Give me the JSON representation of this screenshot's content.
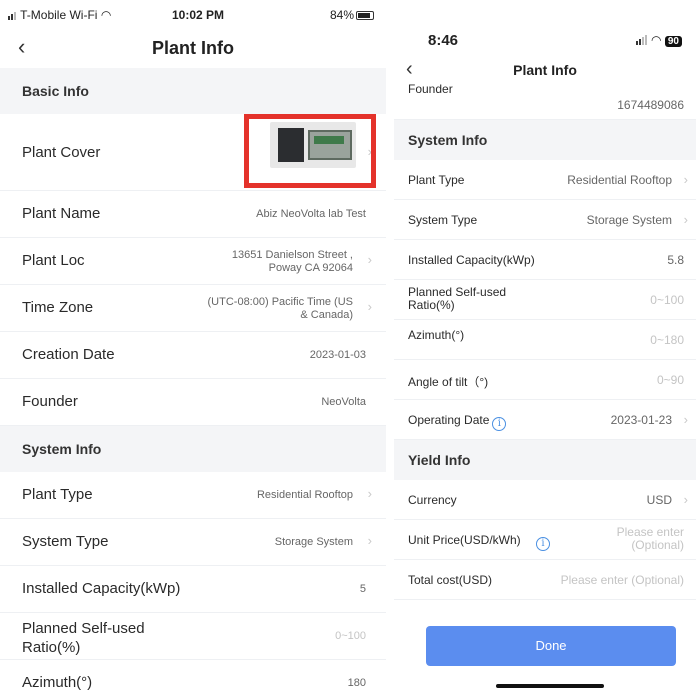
{
  "left": {
    "status": {
      "carrier": "T-Mobile Wi-Fi",
      "wifi_icon": "wifi-icon",
      "time": "10:02 PM",
      "battery": "84%"
    },
    "title": "Plant Info",
    "sections": {
      "basic": "Basic Info",
      "system": "System Info"
    },
    "rows": {
      "plant_cover": "Plant Cover",
      "plant_name": {
        "label": "Plant Name",
        "value": "Abiz NeoVolta lab Test"
      },
      "plant_loc": {
        "label": "Plant Loc",
        "line1": "13651 Danielson Street ,",
        "line2": "Poway CA 92064"
      },
      "time_zone": {
        "label": "Time Zone",
        "line1": "(UTC-08:00) Pacific Time (US",
        "line2": "& Canada)"
      },
      "creation_date": {
        "label": "Creation Date",
        "value": "2023-01-03"
      },
      "founder": {
        "label": "Founder",
        "value": "NeoVolta"
      },
      "plant_type": {
        "label": "Plant Type",
        "value": "Residential Rooftop"
      },
      "system_type": {
        "label": "System Type",
        "value": "Storage System"
      },
      "installed_capacity": {
        "label": "Installed Capacity(kWp)",
        "value": "5"
      },
      "self_used": {
        "label_line1": "Planned Self-used",
        "label_line2": "Ratio(%)",
        "value": "0~100"
      },
      "azimuth": {
        "label": "Azimuth(°)",
        "value": "180"
      }
    }
  },
  "right": {
    "status": {
      "time": "8:46",
      "battery": "90"
    },
    "title": "Plant Info",
    "founder_label": "Founder",
    "founder_value": "1674489086",
    "sections": {
      "system": "System Info",
      "yield": "Yield Info"
    },
    "rows": {
      "plant_type": {
        "label": "Plant Type",
        "value": "Residential Rooftop"
      },
      "system_type": {
        "label": "System Type",
        "value": "Storage System"
      },
      "installed_capacity": {
        "label": "Installed Capacity(kWp)",
        "value": "5.8"
      },
      "self_used": {
        "label_line1": "Planned Self-used",
        "label_line2": "Ratio(%)",
        "value": "0~100"
      },
      "azimuth": {
        "label": "Azimuth(°)",
        "value": "0~180"
      },
      "tilt": {
        "label": "Angle of tilt（°)",
        "value": "0~90"
      },
      "operating_date": {
        "label": "Operating Date",
        "value": "2023-01-23"
      },
      "currency": {
        "label": "Currency",
        "value": "USD"
      },
      "unit_price": {
        "label": "Unit Price(USD/kWh)",
        "line1": "Please enter",
        "line2": "(Optional)"
      },
      "total_cost": {
        "label": "Total cost(USD)",
        "placeholder": "Please enter (Optional)"
      }
    },
    "done_label": "Done"
  },
  "colors": {
    "accent": "#5b8def",
    "highlight": "#e4322b",
    "section_bg": "#f4f5f7"
  },
  "icons": [
    "back-chevron-icon",
    "chevron-right-icon",
    "info-icon",
    "wifi-icon",
    "signal-icon",
    "battery-icon"
  ]
}
